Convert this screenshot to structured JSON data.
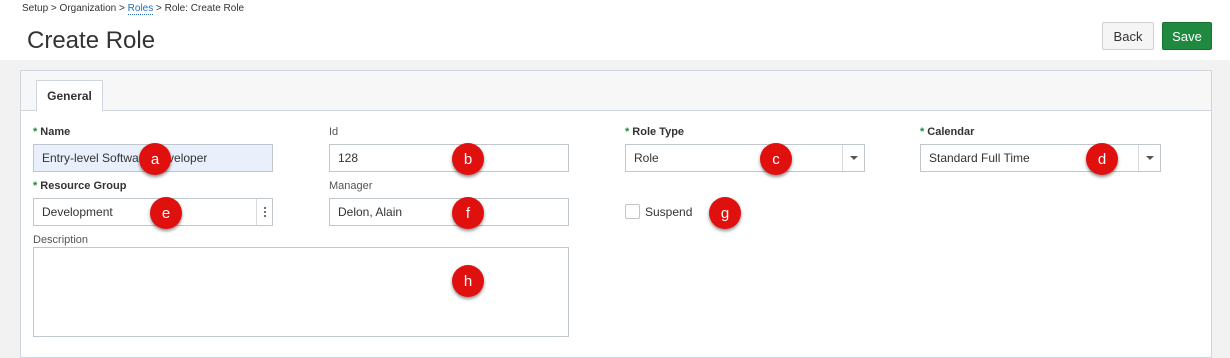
{
  "breadcrumb": {
    "setup": "Setup",
    "sep1": " > ",
    "organization": "Organization",
    "sep2": " > ",
    "roles": "Roles",
    "sep3": " > ",
    "current": "Role: Create Role"
  },
  "page": {
    "title": "Create Role"
  },
  "toolbar": {
    "back_label": "Back",
    "save_label": "Save"
  },
  "tabs": [
    {
      "label": "General",
      "active": true
    }
  ],
  "form": {
    "name": {
      "label": "Name",
      "value": "Entry-level Software Developer",
      "required": true
    },
    "id": {
      "label": "Id",
      "value": "128"
    },
    "role_type": {
      "label": "Role Type",
      "value": "Role",
      "required": true
    },
    "calendar": {
      "label": "Calendar",
      "value": "Standard Full Time",
      "required": true
    },
    "resource_group": {
      "label": "Resource Group",
      "value": "Development",
      "required": true
    },
    "manager": {
      "label": "Manager",
      "value": "Delon, Alain"
    },
    "suspend": {
      "label": "Suspend",
      "checked": false
    },
    "description": {
      "label": "Description",
      "value": ""
    }
  },
  "markers": [
    "a",
    "b",
    "c",
    "d",
    "e",
    "f",
    "g",
    "h"
  ],
  "colors": {
    "save": "#1f8a3f",
    "required_star": "#1f8a3f",
    "marker": "#e0100f",
    "link": "#2a6db5"
  }
}
